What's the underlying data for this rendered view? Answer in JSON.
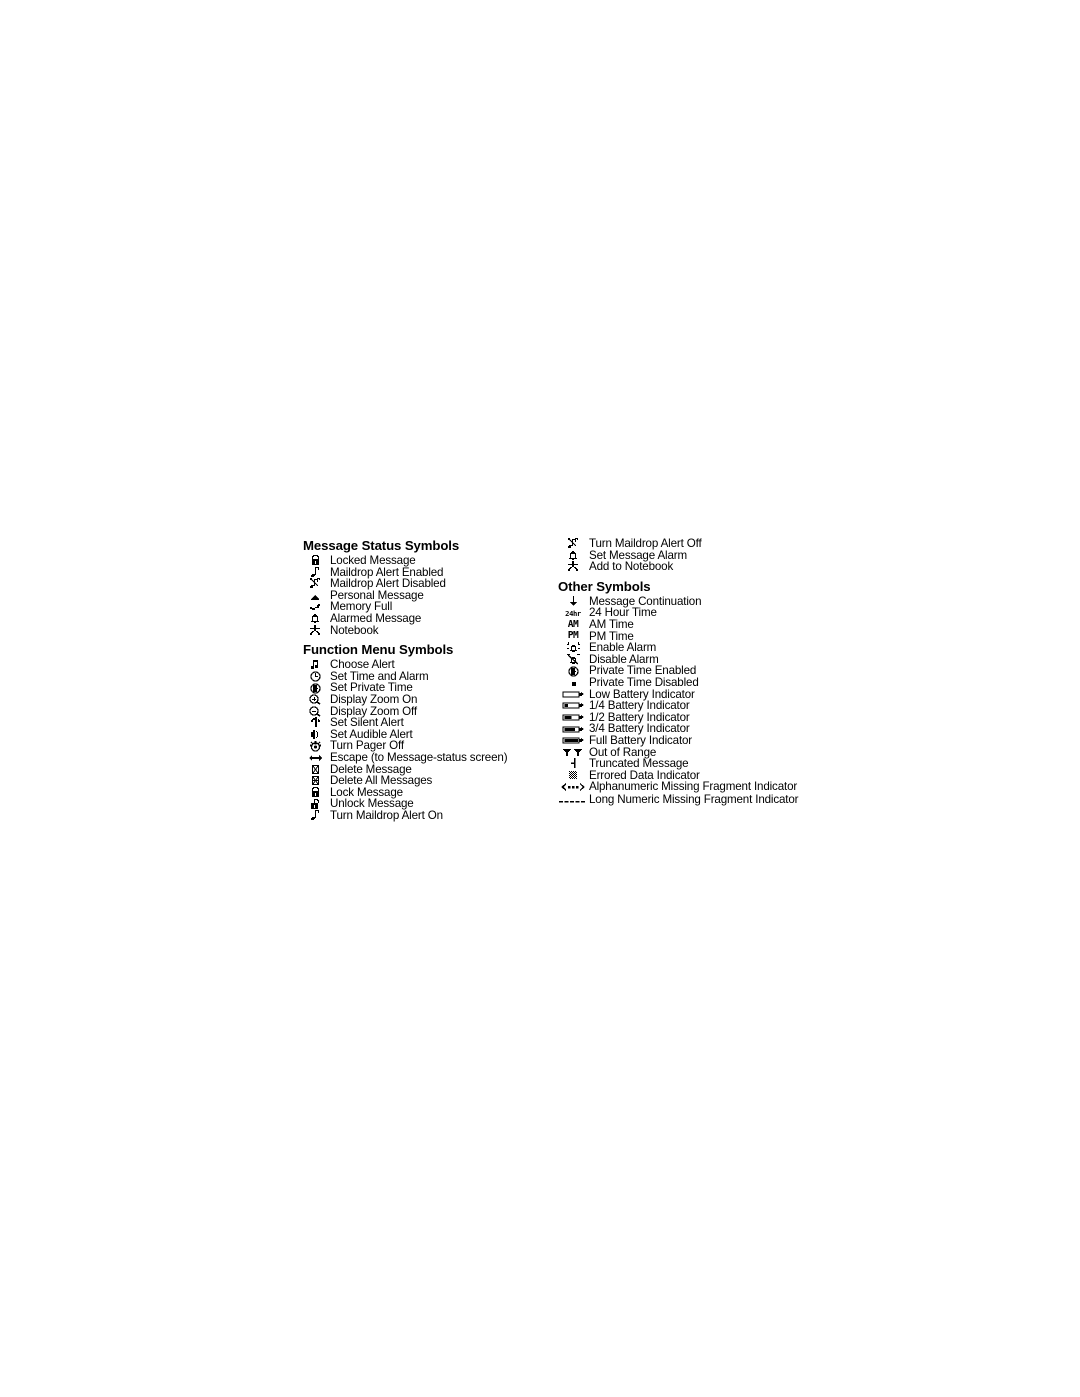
{
  "document": {
    "page_background": "#ffffff",
    "text_color": "#000000"
  },
  "sections": [
    {
      "id": "message-status-symbols",
      "title": "Message Status Symbols",
      "column": "left",
      "items": [
        {
          "icon": "padlock-closed-icon",
          "label": "Locked Message"
        },
        {
          "icon": "music-note-icon",
          "label": "Maildrop Alert Enabled"
        },
        {
          "icon": "music-note-crossed-icon",
          "label": "Maildrop Alert Disabled"
        },
        {
          "icon": "envelope-small-icon",
          "label": "Personal Message"
        },
        {
          "icon": "memory-full-icon",
          "label": "Memory Full"
        },
        {
          "icon": "bell-outline-icon",
          "label": "Alarmed Message"
        },
        {
          "icon": "notebook-person-icon",
          "label": "Notebook"
        }
      ]
    },
    {
      "id": "function-menu-symbols",
      "title": "Function Menu Symbols",
      "column": "left",
      "items": [
        {
          "icon": "double-music-note-icon",
          "label": "Choose Alert"
        },
        {
          "icon": "clock-icon",
          "label": "Set Time and Alarm"
        },
        {
          "icon": "private-clock-icon",
          "label": "Set Private Time"
        },
        {
          "icon": "magnifier-plus-icon",
          "label": "Display Zoom On"
        },
        {
          "icon": "magnifier-minus-icon",
          "label": "Display Zoom Off"
        },
        {
          "icon": "vibrate-icon",
          "label": "Set Silent Alert"
        },
        {
          "icon": "speaker-icon",
          "label": "Set Audible Alert"
        },
        {
          "icon": "power-off-icon",
          "label": "Turn Pager Off"
        },
        {
          "icon": "left-right-arrow-icon",
          "label": "Escape (to Message-status screen)"
        },
        {
          "icon": "delete-message-icon",
          "label": "Delete Message"
        },
        {
          "icon": "delete-all-messages-icon",
          "label": "Delete All Messages"
        },
        {
          "icon": "padlock-closed-icon",
          "label": "Lock  Message"
        },
        {
          "icon": "padlock-open-icon",
          "label": "Unlock  Message"
        },
        {
          "icon": "music-note-icon",
          "label": "Turn Maildrop Alert On"
        }
      ]
    },
    {
      "id": "turn-maildrop-group",
      "title": null,
      "column": "right",
      "items": [
        {
          "icon": "music-note-crossed-icon",
          "label": "Turn Maildrop Alert Off"
        },
        {
          "icon": "bell-outline-icon",
          "label": "Set Message Alarm"
        },
        {
          "icon": "notebook-person-icon",
          "label": "Add to Notebook"
        }
      ]
    },
    {
      "id": "other-symbols",
      "title": "Other Symbols",
      "column": "right",
      "items": [
        {
          "icon": "down-arrow-icon",
          "label": "Message Continuation"
        },
        {
          "icon": "24hr-text-icon",
          "icon_text": "24hr",
          "label": "24 Hour Time"
        },
        {
          "icon": "am-text-icon",
          "icon_text": "AM",
          "label": "AM Time"
        },
        {
          "icon": "pm-text-icon",
          "icon_text": "PM",
          "label": "PM Time"
        },
        {
          "icon": "alarm-bell-ringing-icon",
          "label": "Enable Alarm"
        },
        {
          "icon": "alarm-bell-crossed-icon",
          "label": "Disable Alarm"
        },
        {
          "icon": "private-clock-icon",
          "label": "Private Time Enabled"
        },
        {
          "icon": "filled-square-icon",
          "label": "Private Time Disabled"
        },
        {
          "icon": "battery-empty-icon",
          "label": "Low Battery Indicator"
        },
        {
          "icon": "battery-quarter-icon",
          "label": "1/4 Battery Indicator"
        },
        {
          "icon": "battery-half-icon",
          "label": "1/2 Battery Indicator"
        },
        {
          "icon": "battery-three-quarter-icon",
          "label": "3/4 Battery Indicator"
        },
        {
          "icon": "battery-full-icon",
          "label": "Full Battery Indicator"
        },
        {
          "icon": "out-of-range-icon",
          "label": "Out of Range"
        },
        {
          "icon": "truncated-message-icon",
          "label": "Truncated Message"
        },
        {
          "icon": "errored-data-icon",
          "label": "Errored Data Indicator"
        },
        {
          "icon": "alphanumeric-fragment-icon",
          "label": "Alphanumeric Missing Fragment\nIndicator"
        },
        {
          "icon": "long-numeric-fragment-icon",
          "label": "Long Numeric Missing Fragment\nIndicator"
        }
      ]
    }
  ]
}
